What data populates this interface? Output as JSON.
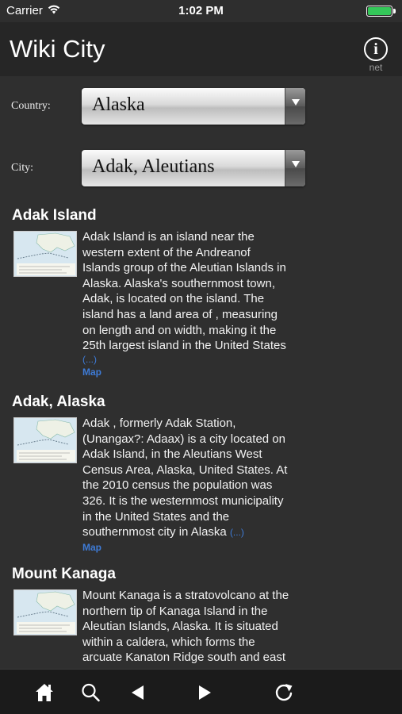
{
  "status_bar": {
    "carrier": "Carrier",
    "time": "1:02 PM"
  },
  "nav": {
    "title": "Wiki City",
    "info_label": "net"
  },
  "pickers": {
    "country": {
      "label": "Country:",
      "value": "Alaska"
    },
    "city": {
      "label": "City:",
      "value": "Adak, Aleutians"
    }
  },
  "articles": [
    {
      "title": "Adak Island",
      "lines": [
        "Adak Island is an island near the",
        "western extent of the Andreanof",
        "Islands group of the Aleutian Islands in",
        "Alaska. Alaska's southernmost town,",
        "Adak, is located on the island. The",
        "island has a land area of , measuring",
        "on length and on width, making it the",
        "25th largest island in the United States"
      ],
      "more": "(...)",
      "map": "Map"
    },
    {
      "title": "Adak, Alaska",
      "lines": [
        "Adak , formerly Adak Station,",
        "(Unangax?: Adaax) is a city located on",
        "Adak Island, in the Aleutians West",
        "Census Area, Alaska, United States. At",
        "the 2010 census the population was",
        "326. It is the westernmost municipality",
        "in the United States and the",
        "southernmost city in Alaska"
      ],
      "more": "(...)",
      "map": "Map"
    },
    {
      "title": "Mount Kanaga",
      "lines": [
        "Mount Kanaga is a stratovolcano at the",
        "northern tip of Kanaga Island in the",
        "Aleutian Islands, Alaska. It is situated",
        "within a caldera, which forms the",
        "arcuate Kanaton Ridge south and east"
      ]
    }
  ],
  "toolbar": {
    "items": [
      "home-icon",
      "search-icon",
      "back-arrow-icon",
      "forward-arrow-icon",
      "refresh-icon"
    ],
    "colors": {
      "background": "#1b1b1b",
      "icon": "#ffffff",
      "link": "#3e7bd6"
    }
  }
}
